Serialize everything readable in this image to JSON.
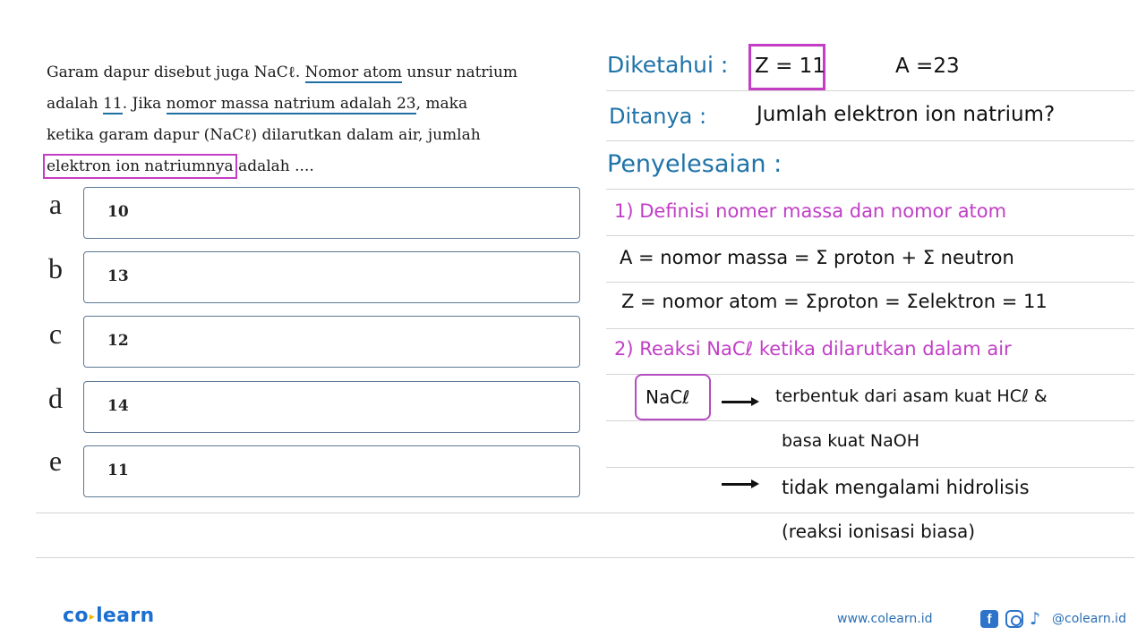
{
  "question": {
    "lines": [
      [
        "Garam dapur disebut juga NaCℓ. ",
        "Nomor atom",
        " unsur natrium"
      ],
      [
        "adalah ",
        "11",
        ". Jika ",
        "nomor massa natrium adalah 23",
        ", maka"
      ],
      [
        "ketika garam dapur (NaCℓ) dilarutkan dalam air, jumlah"
      ],
      [
        "elektron ion natriumnya",
        " adalah ...."
      ]
    ]
  },
  "options": [
    {
      "letter": "a",
      "value": "10"
    },
    {
      "letter": "b",
      "value": "13"
    },
    {
      "letter": "c",
      "value": "12"
    },
    {
      "letter": "d",
      "value": "14"
    },
    {
      "letter": "e",
      "value": "11"
    }
  ],
  "solution": {
    "diketahui_label": "Diketahui :",
    "z_value": "Z = 11",
    "a_value": "A =23",
    "ditanya_label": "Ditanya :",
    "ditanya_text": "Jumlah elektron ion natrium?",
    "penyelesaian_label": "Penyelesaian :",
    "step1_title": "1) Definisi nomer massa dan nomor atom",
    "step1_line1": "A = nomor massa = Σ proton + Σ neutron",
    "step1_line2": "Z = nomor atom = Σproton = Σelektron = 11",
    "step2_title": "2) Reaksi NaCℓ ketika dilarutkan dalam air",
    "nacl_label": "NaCℓ",
    "step2_line1": "terbentuk dari asam kuat HCℓ &",
    "step2_line2": "basa kuat NaOH",
    "step2_line3": "tidak mengalami hidrolisis",
    "step2_line4": "(reaksi ionisasi biasa)"
  },
  "footer": {
    "logo_left": "co",
    "logo_right": "learn",
    "website": "www.colearn.id",
    "social_icons": [
      "facebook-icon",
      "instagram-icon",
      "tiktok-icon"
    ],
    "handle": "@colearn.id"
  },
  "colors": {
    "accent_blue": "#1f73a8",
    "accent_pink": "#c33ec5",
    "brand_blue": "#1c6fd0"
  }
}
